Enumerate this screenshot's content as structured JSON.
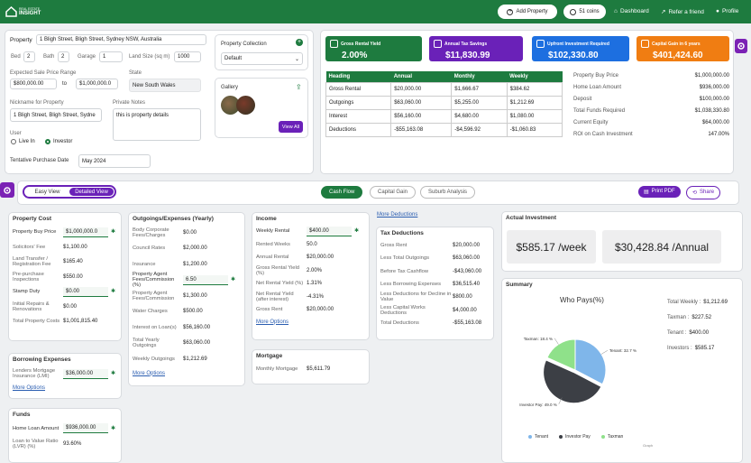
{
  "header": {
    "logo_line1": "REAL ESTATE",
    "logo_line2": "INSIGHT",
    "add_property": "Add Property",
    "coins": "51 coins",
    "dashboard": "Dashboard",
    "refer": "Refer a friend",
    "profile": "Profile"
  },
  "property": {
    "property_label": "Property",
    "property_value": "1 Bligh Street, Bligh Street, Sydney NSW, Australia",
    "bed_label": "Bed",
    "bed": "2",
    "bath_label": "Bath",
    "bath": "2",
    "garage_label": "Garage",
    "garage": "1",
    "land_label": "Land Size (sq m)",
    "land": "1000",
    "price_range_label": "Expected Sale Price Range",
    "price_min": "$800,000.00",
    "to": "to",
    "price_max": "$1,000,000.0",
    "state_label": "State",
    "state": "New South Wales",
    "nickname_label": "Nickname for Property",
    "nickname": "1 Bligh Street, Bligh Street, Sydne",
    "notes_label": "Private Notes",
    "notes": "this is property details",
    "user_label": "User",
    "live_in": "Live In",
    "investor": "Investor",
    "tpd_label": "Tentative Purchase Date",
    "tpd": "May 2024",
    "collection_label": "Property Collection",
    "collection": "Default",
    "gallery_label": "Gallery",
    "view_all": "View All"
  },
  "cards": [
    {
      "title": "Gross Rental Yield",
      "value": "2.00%",
      "color": "#1e7b3f"
    },
    {
      "title": "Annual Tax Savings",
      "value": "$11,830.99",
      "color": "#6a21b8"
    },
    {
      "title": "Upfront Investment Required",
      "value": "$102,330.80",
      "color": "#1d6fe0"
    },
    {
      "title": "Capital Gain in 6 years",
      "value": "$401,424.60",
      "color": "#f07d12"
    }
  ],
  "summary_table": {
    "headers": [
      "Heading",
      "Annual",
      "Monthly",
      "Weekly"
    ],
    "rows": [
      [
        "Gross Rental",
        "$20,000.00",
        "$1,666.67",
        "$384.62"
      ],
      [
        "Outgoings",
        "$63,060.00",
        "$5,255.00",
        "$1,212.69"
      ],
      [
        "Interest",
        "$56,160.00",
        "$4,680.00",
        "$1,080.00"
      ],
      [
        "Deductions",
        "-$55,163.08",
        "-$4,596.92",
        "-$1,060.83"
      ]
    ]
  },
  "right_kv": [
    [
      "Property Buy Price",
      "$1,000,000.00"
    ],
    [
      "Home Loan Amount",
      "$936,000.00"
    ],
    [
      "Deposit",
      "$100,000.00"
    ],
    [
      "Total Funds Required",
      "$1,038,330.80"
    ],
    [
      "Current Equity",
      "$64,000.00"
    ],
    [
      "ROI on Cash Investment",
      "147.00%"
    ]
  ],
  "toolbar": {
    "easy": "Easy View",
    "detailed": "Detailed View",
    "cashflow": "Cash Flow",
    "capital": "Capital Gain",
    "suburb": "Suburb Analysis",
    "print": "Print PDF",
    "share": "Share"
  },
  "property_cost": {
    "title": "Property Cost",
    "rows": [
      [
        "Property Buy Price",
        "$1,000,000.0"
      ],
      [
        "Solicitors' Fee",
        "$1,100.00"
      ],
      [
        "Land Transfer / Registration Fee",
        "$165.40"
      ],
      [
        "Pre-purchase Inspections",
        "$550.00"
      ],
      [
        "Stamp Duty",
        "$0.00"
      ],
      [
        "Initial Repairs & Renovations",
        "$0.00"
      ],
      [
        "Total Property Costs",
        "$1,001,815.40"
      ]
    ]
  },
  "borrowing": {
    "title": "Borrowing Expenses",
    "row": [
      "Lenders Mortgage Insurance (LMI)",
      "$36,000.00"
    ],
    "more": "More Options"
  },
  "funds": {
    "title": "Funds",
    "rows": [
      [
        "Home Loan Amount",
        "$936,000.00"
      ],
      [
        "Loan to Value Ratio (LVR) (%)",
        "93.60%"
      ]
    ]
  },
  "outgoings": {
    "title": "Outgoings/Expenses (Yearly)",
    "rows": [
      [
        "Body Corporate Fees/Charges",
        "$0.00"
      ],
      [
        "Council Rates",
        "$2,000.00"
      ],
      [
        "Insurance",
        "$1,200.00"
      ],
      [
        "Property Agent Fees/Commission (%)",
        "6.50"
      ],
      [
        "Property Agent Fees/Commission",
        "$1,300.00"
      ],
      [
        "Water Charges",
        "$500.00"
      ],
      [
        "Interest on Loan(s)",
        "$56,160.00"
      ],
      [
        "Total Yearly Outgoings",
        "$63,060.00"
      ],
      [
        "Weekly Outgoings",
        "$1,212.69"
      ]
    ],
    "more": "More Options"
  },
  "income": {
    "title": "Income",
    "rows": [
      [
        "Weekly Rental",
        "$400.00"
      ],
      [
        "Rented Weeks",
        "50.0"
      ],
      [
        "Annual Rental",
        "$20,000.00"
      ],
      [
        "Gross Rental Yield (%)",
        "2.00%"
      ],
      [
        "Net Rental Yield (%)",
        "1.31%"
      ],
      [
        "Net Rental Yield (after interest)",
        "-4.31%"
      ],
      [
        "Gross Rent",
        "$20,000.00"
      ]
    ],
    "more": "More Options"
  },
  "mortgage": {
    "title": "Mortgage",
    "row": [
      "Monthly Mortgage",
      "$5,611.79"
    ]
  },
  "more_deductions": "More Deductions",
  "tax": {
    "title": "Tax Deductions",
    "rows": [
      [
        "Gross Rent",
        "$20,000.00"
      ],
      [
        "Less Total Outgoings",
        "$63,060.00"
      ],
      [
        "Before Tax Cashflow",
        "-$43,060.00"
      ],
      [
        "Less Borrowing Expenses",
        "$36,515.40"
      ],
      [
        "Less Deductions for Decline in Value",
        "$800.00"
      ],
      [
        "Less Capital Works Deductions",
        "$4,000.00"
      ],
      [
        "Total Deductions",
        "-$55,163.08"
      ]
    ]
  },
  "actual": {
    "title": "Actual Investment",
    "week": "$585.17 /week",
    "annual": "$30,428.84 /Annual"
  },
  "summary": {
    "title": "Summary",
    "who_pays": "Who Pays(%)",
    "graph": "Graph",
    "legend": [
      [
        "Tenant",
        "#7fb6ea"
      ],
      [
        "Investor Pay",
        "#3c3f45"
      ],
      [
        "Taxman",
        "#8fe18a"
      ]
    ],
    "kv": [
      [
        "Total Weekly :",
        "$1,212.69"
      ],
      [
        "Taxman :",
        "$227.52"
      ],
      [
        "Tenant :",
        "$400.00"
      ],
      [
        "Investors :",
        "$585.17"
      ]
    ]
  },
  "chart_data": {
    "type": "pie",
    "title": "Who Pays(%)",
    "categories": [
      "Tenant",
      "Investor Pay",
      "Taxman"
    ],
    "values": [
      32.7,
      49.0,
      18.4
    ],
    "labels": [
      "Tenant: 32.7 %",
      "Investor Pay: 49.0 %",
      "Taxman: 18.4 %"
    ],
    "colors": [
      "#7fb6ea",
      "#3c3f45",
      "#8fe18a"
    ],
    "legend_position": "bottom"
  }
}
